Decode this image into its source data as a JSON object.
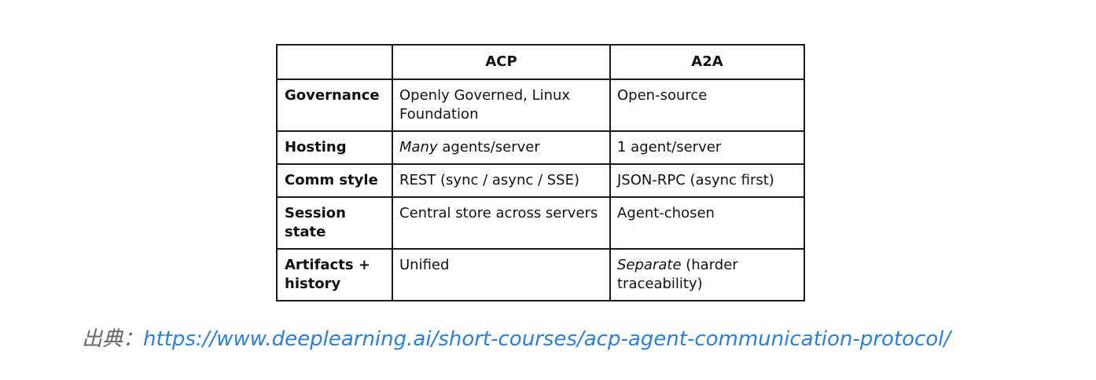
{
  "table": {
    "headers": [
      "",
      "ACP",
      "A2A"
    ],
    "rows": [
      {
        "label": "Governance",
        "acp": "Openly Governed, Linux Foundation",
        "a2a": "Open-source"
      },
      {
        "label": "Hosting",
        "acp_emph": "Many",
        "acp_rest": " agents/server",
        "a2a": "1 agent/server"
      },
      {
        "label": "Comm style",
        "acp": "REST (sync / async / SSE)",
        "a2a": "JSON-RPC (async first)"
      },
      {
        "label": "Session state",
        "acp": "Central store across servers",
        "a2a": "Agent-chosen"
      },
      {
        "label": "Artifacts + history",
        "acp": "Unified",
        "a2a_emph": "Separate",
        "a2a_rest": " (harder traceability)"
      }
    ]
  },
  "source": {
    "prefix": "出典：",
    "url": "https://www.deeplearning.ai/short-courses/acp-agent-communication-protocol/"
  },
  "colors": {
    "link": "#2b7fd6",
    "prefix": "#666666",
    "border": "#1a1a1a"
  }
}
